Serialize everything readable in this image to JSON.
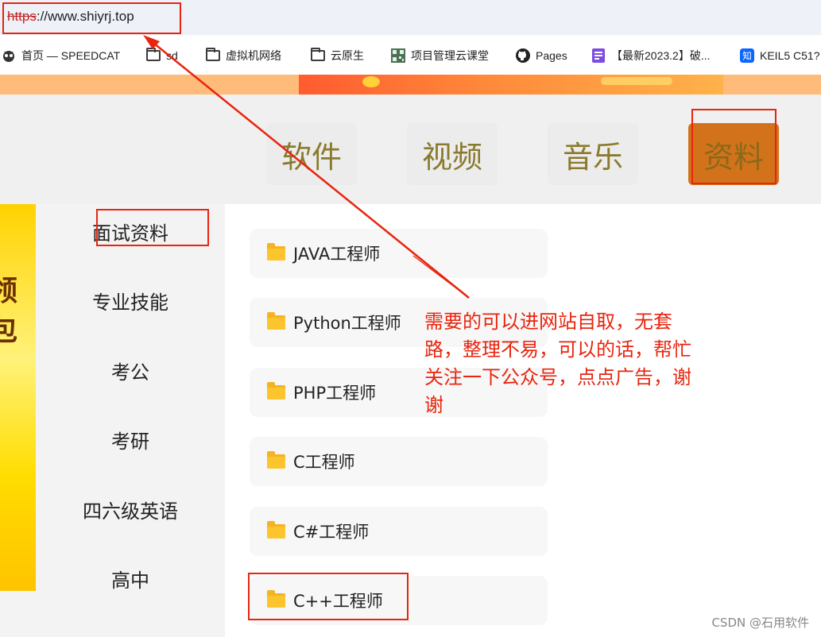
{
  "browser": {
    "url_scheme": "https",
    "url_rest": "://www.shiyrj.top"
  },
  "bookmarks": [
    {
      "icon": "speedcat-icon",
      "label": "首页 — SPEEDCAT"
    },
    {
      "icon": "folder-icon",
      "label": "sd"
    },
    {
      "icon": "folder-icon",
      "label": "虚拟机网络"
    },
    {
      "icon": "folder-icon",
      "label": "云原生"
    },
    {
      "icon": "qr-icon",
      "label": "项目管理云课堂"
    },
    {
      "icon": "github-icon",
      "label": "Pages"
    },
    {
      "icon": "bookmark-purple-icon",
      "label": "【最新2023.2】破..."
    },
    {
      "icon": "zhihu-icon",
      "label": "KEIL5 C51?"
    }
  ],
  "nav": {
    "items": [
      "软件",
      "视频",
      "音乐",
      "资料"
    ],
    "active": "资料"
  },
  "sidebar": {
    "items": [
      "面试资料",
      "专业技能",
      "考公",
      "考研",
      "四六级英语",
      "高中"
    ],
    "strip_glyphs": [
      "领",
      "包"
    ]
  },
  "categories": [
    "JAVA工程师",
    "Python工程师",
    "PHP工程师",
    "C工程师",
    "C#工程师",
    "C++工程师"
  ],
  "annotation": {
    "note": "需要的可以进网站自取，无套路，整理不易，可以的话，帮忙关注一下公众号，点点广告，谢谢",
    "color": "#e8250f"
  },
  "watermark": "CSDN @石用软件"
}
